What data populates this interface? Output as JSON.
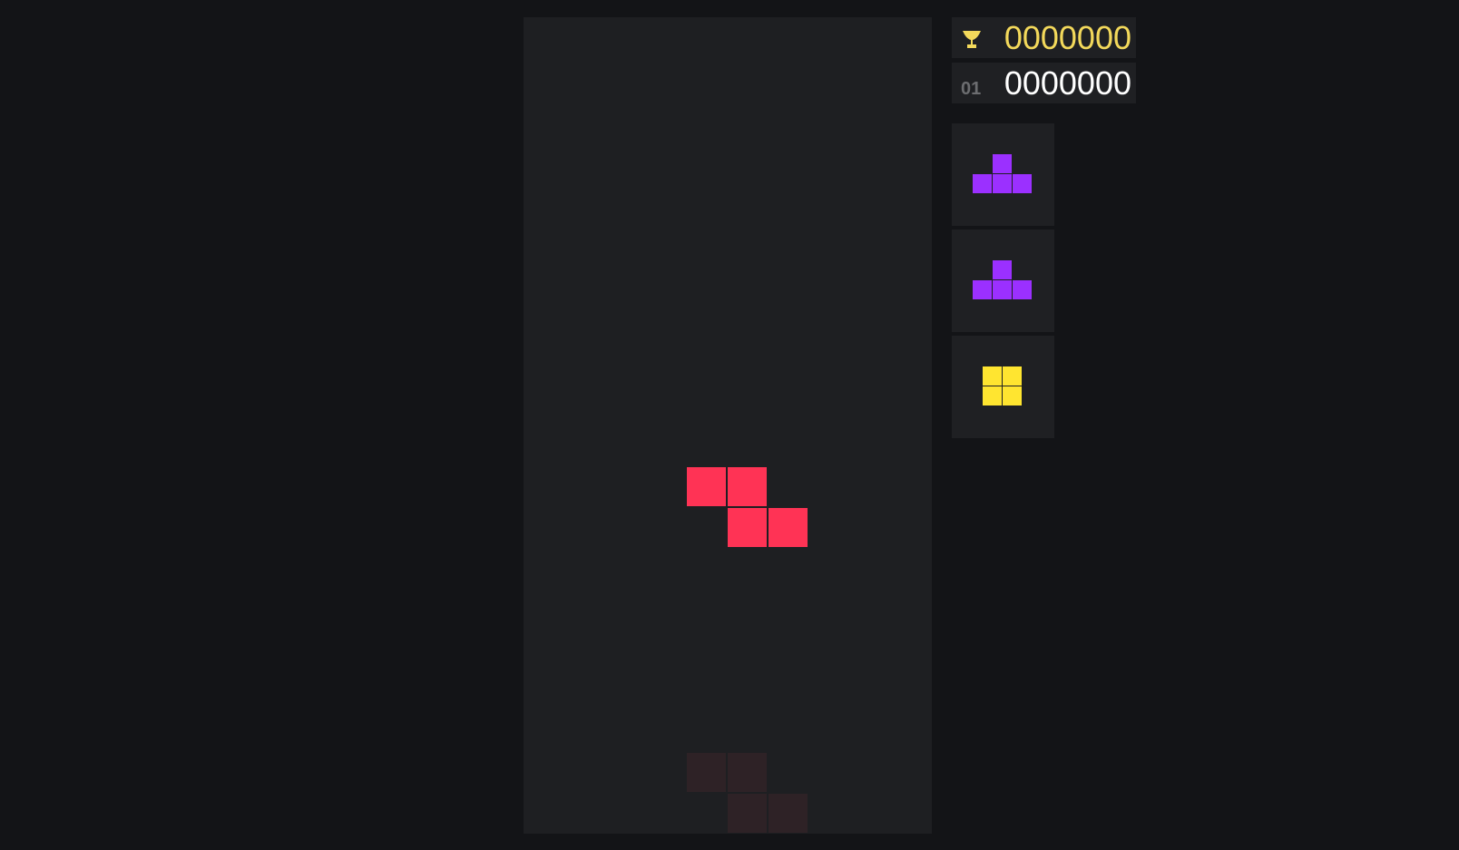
{
  "score": {
    "high": "0000000",
    "current": "0000000",
    "level": "01",
    "high_icon": "trophy-icon"
  },
  "colors": {
    "background": "#131417",
    "board": "#1e1f22",
    "panel": "#1f2023",
    "z_piece": "#ff3355",
    "ghost": "#2e2226",
    "t_piece": "#9b30ff",
    "o_piece": "#ffe530",
    "high_score": "#f3d95b"
  },
  "board": {
    "columns": 10,
    "rows": 20,
    "active_piece": "Z",
    "ghost_piece": "Z"
  },
  "next_queue": [
    "T",
    "T",
    "O"
  ]
}
